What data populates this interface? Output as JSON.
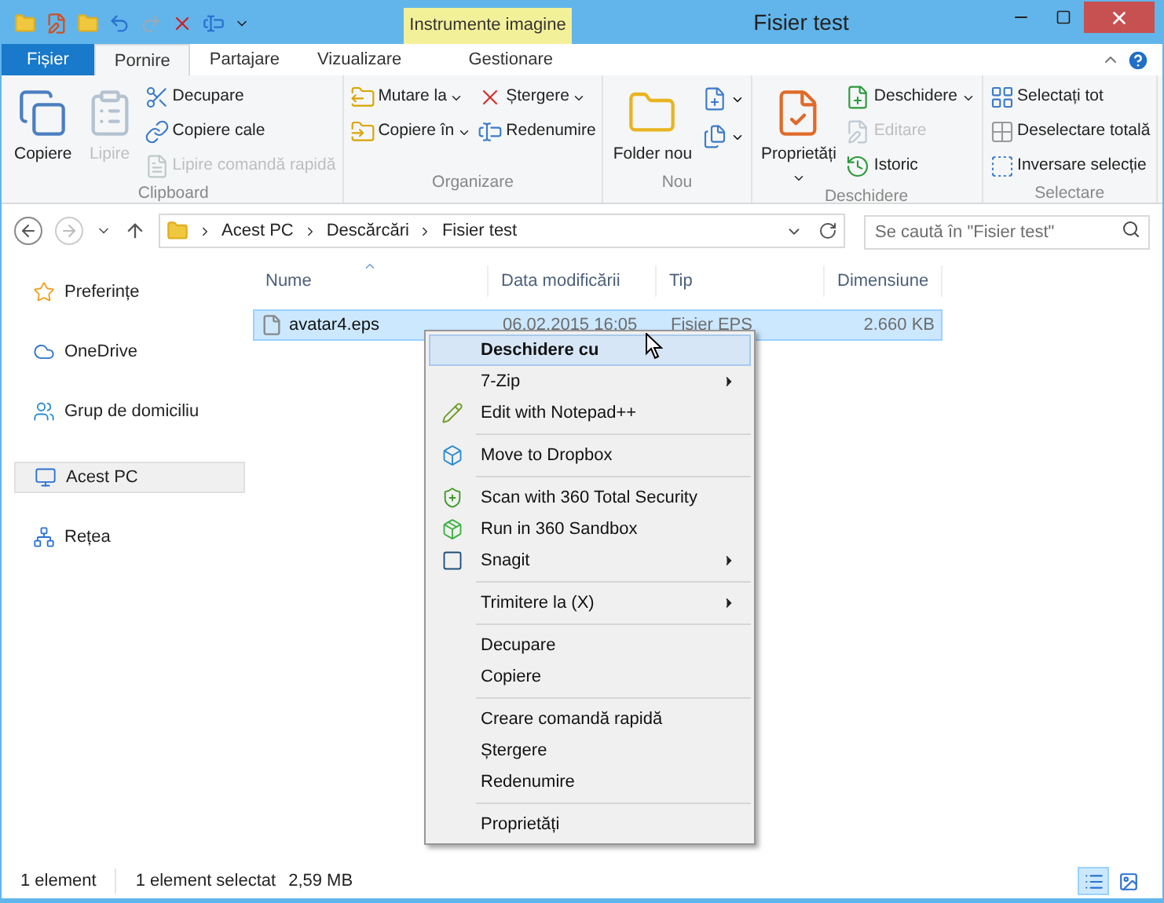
{
  "window": {
    "title": "Fisier test"
  },
  "contextual_group": {
    "label": "Instrumente imagine"
  },
  "tabs": [
    {
      "label": "Fișier",
      "kind": "file",
      "selected": false
    },
    {
      "label": "Pornire",
      "kind": "normal",
      "selected": true
    },
    {
      "label": "Partajare",
      "kind": "normal",
      "selected": false
    },
    {
      "label": "Vizualizare",
      "kind": "normal",
      "selected": false
    },
    {
      "label": "Gestionare",
      "kind": "contextual",
      "selected": false
    }
  ],
  "ribbon": {
    "groups": [
      {
        "title": "Clipboard",
        "columns": [
          [
            {
              "label": "Copiere",
              "kind": "large",
              "disabled": false,
              "dropdown": false
            }
          ],
          [
            {
              "label": "Lipire",
              "kind": "large",
              "disabled": true,
              "dropdown": false
            }
          ],
          [
            {
              "label": "Decupare",
              "kind": "small",
              "disabled": false,
              "dropdown": false
            },
            {
              "label": "Copiere cale",
              "kind": "small",
              "disabled": false,
              "dropdown": false
            },
            {
              "label": "Lipire comandă rapidă",
              "kind": "small",
              "disabled": true,
              "dropdown": false
            }
          ]
        ]
      },
      {
        "title": "Organizare",
        "columns": [
          [
            {
              "label": "Mutare la",
              "kind": "small",
              "disabled": false,
              "dropdown": true
            },
            {
              "label": "Copiere în",
              "kind": "small",
              "disabled": false,
              "dropdown": true
            }
          ],
          [
            {
              "label": "Ștergere",
              "kind": "small",
              "disabled": false,
              "dropdown": true
            },
            {
              "label": "Redenumire",
              "kind": "small",
              "disabled": false,
              "dropdown": false
            }
          ]
        ]
      },
      {
        "title": "Nou",
        "columns": [
          [
            {
              "label": "Folder nou",
              "kind": "large",
              "disabled": false,
              "dropdown": false
            }
          ],
          [
            {
              "kind": "icon",
              "dropdown": true
            },
            {
              "kind": "icon",
              "dropdown": true
            }
          ]
        ]
      },
      {
        "title": "Deschidere",
        "columns": [
          [
            {
              "label": "Proprietăți",
              "kind": "large",
              "disabled": false,
              "dropdown": true
            }
          ],
          [
            {
              "label": "Deschidere",
              "kind": "small",
              "disabled": false,
              "dropdown": true
            },
            {
              "label": "Editare",
              "kind": "small",
              "disabled": true,
              "dropdown": false
            },
            {
              "label": "Istoric",
              "kind": "small",
              "disabled": false,
              "dropdown": false
            }
          ]
        ]
      },
      {
        "title": "Selectare",
        "columns": [
          [
            {
              "label": "Selectați tot",
              "kind": "small",
              "disabled": false,
              "dropdown": false
            },
            {
              "label": "Deselectare totală",
              "kind": "small",
              "disabled": false,
              "dropdown": false
            },
            {
              "label": "Inversare selecție",
              "kind": "small",
              "disabled": false,
              "dropdown": false
            }
          ]
        ]
      }
    ]
  },
  "address_bar": {
    "path": [
      "Acest PC",
      "Descărcări",
      "Fisier test"
    ]
  },
  "search": {
    "placeholder": "Se caută în \"Fisier test\""
  },
  "navigation": [
    {
      "label": "Preferințe",
      "selected": false
    },
    {
      "label": "OneDrive",
      "selected": false
    },
    {
      "label": "Grup de domiciliu",
      "selected": false
    },
    {
      "label": "Acest PC",
      "selected": true
    },
    {
      "label": "Rețea",
      "selected": false
    }
  ],
  "table": {
    "columns": [
      {
        "label": "Nume",
        "sorted": true
      },
      {
        "label": "Data modificării",
        "sorted": false
      },
      {
        "label": "Tip",
        "sorted": false
      },
      {
        "label": "Dimensiune",
        "sorted": false
      }
    ],
    "rows": [
      {
        "name": "avatar4.eps",
        "date": "06.02.2015 16:05",
        "type": "Fisier EPS",
        "size": "2.660 KB",
        "selected": true
      }
    ]
  },
  "context_menu": {
    "sections": [
      [
        {
          "label": "Deschidere cu",
          "default": true,
          "selected": true,
          "submenu": false
        },
        {
          "label": "7-Zip",
          "default": false,
          "selected": false,
          "submenu": true
        },
        {
          "label": "Edit with Notepad++",
          "default": false,
          "selected": false,
          "submenu": false
        }
      ],
      [
        {
          "label": "Move to Dropbox",
          "default": false,
          "selected": false,
          "submenu": false
        }
      ],
      [
        {
          "label": "Scan with 360 Total Security",
          "default": false,
          "selected": false,
          "submenu": false
        },
        {
          "label": "Run in 360 Sandbox",
          "default": false,
          "selected": false,
          "submenu": false
        },
        {
          "label": "Snagit",
          "default": false,
          "selected": false,
          "submenu": true
        }
      ],
      [
        {
          "label": "Trimitere la (X)",
          "default": false,
          "selected": false,
          "submenu": true
        }
      ],
      [
        {
          "label": "Decupare",
          "default": false,
          "selected": false,
          "submenu": false
        },
        {
          "label": "Copiere",
          "default": false,
          "selected": false,
          "submenu": false
        }
      ],
      [
        {
          "label": "Creare comandă rapidă",
          "default": false,
          "selected": false,
          "submenu": false
        },
        {
          "label": "Ștergere",
          "default": false,
          "selected": false,
          "submenu": false
        },
        {
          "label": "Redenumire",
          "default": false,
          "selected": false,
          "submenu": false
        }
      ],
      [
        {
          "label": "Proprietăți",
          "default": false,
          "selected": false,
          "submenu": false
        }
      ]
    ]
  },
  "status_bar": {
    "items": [
      "1 element",
      "1 element selectat",
      "2,59 MB"
    ],
    "views": [
      {
        "kind": "details",
        "selected": true
      },
      {
        "kind": "thumbnails",
        "selected": false
      }
    ]
  }
}
